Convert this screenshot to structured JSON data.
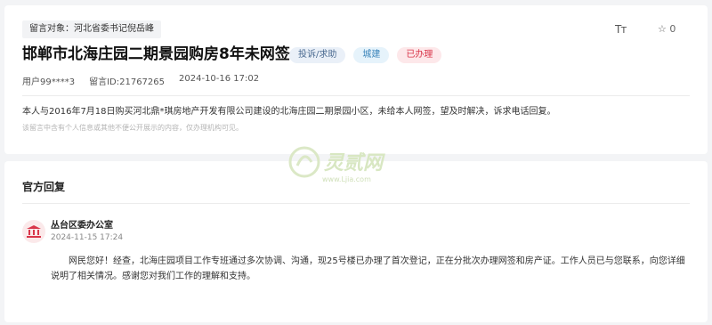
{
  "message": {
    "target_label": "留言对象：河北省委书记倪岳峰",
    "title": "邯郸市北海庄园二期景园购房8年未网签",
    "badges": [
      "投诉/求助",
      "城建",
      "已办理"
    ],
    "user": "用户99****3",
    "message_id": "留言ID:21767265",
    "time": "2024-10-16 17:02",
    "content": "本人与2016年7月18日购买河北鼎*琪房地产开发有限公司建设的北海庄园二期景园小区，未给本人网签，望及时解决，诉求电话回复。",
    "notice": "该留言中含有个人信息或其他不便公开展示的内容，仅办理机构可见。",
    "star_count": "0",
    "font_toggle": "Tт"
  },
  "reply": {
    "header": "官方回复",
    "department": "丛台区委办公室",
    "time": "2024-11-15 17:24",
    "body": "网民您好！经查，北海庄园项目工作专班通过多次协调、沟通，现25号楼已办理了首次登记，正在分批次办理网签和房产证。工作人员已与您联系，向您详细说明了相关情况。感谢您对我们工作的理解和支持。"
  },
  "watermark": {
    "brand": "灵贰网",
    "url": "www.Ljia.com"
  },
  "colors": {
    "status_red": "#d9364a",
    "dept_blue": "#3d86bb",
    "type_slate": "#4a6a90",
    "page_bg": "#f3f4f6"
  },
  "icons": {
    "font_size": "font-size-icon",
    "star": "star-icon",
    "department": "building-icon"
  }
}
